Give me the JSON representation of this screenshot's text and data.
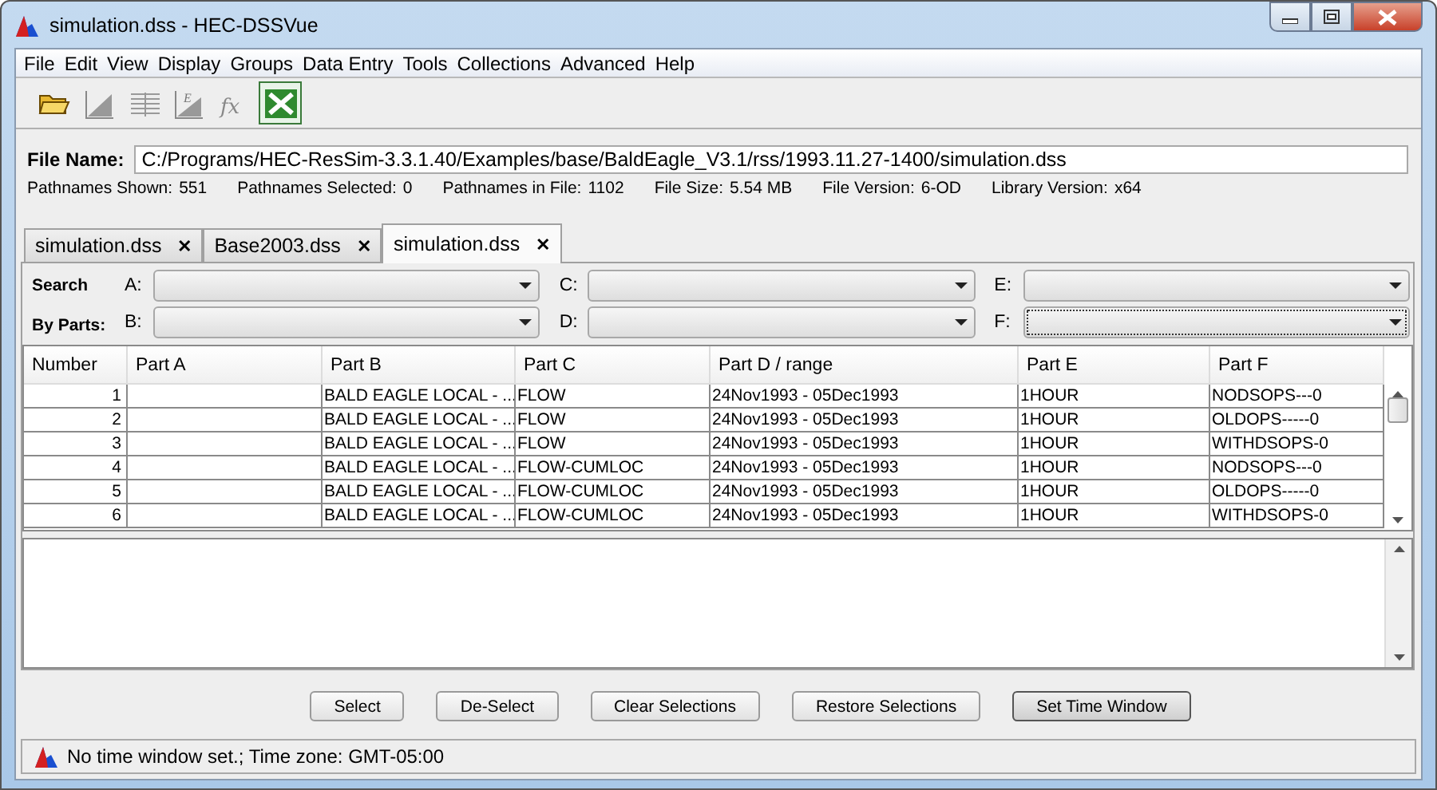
{
  "window": {
    "title": "simulation.dss - HEC-DSSVue"
  },
  "menu": [
    "File",
    "Edit",
    "View",
    "Display",
    "Groups",
    "Data Entry",
    "Tools",
    "Collections",
    "Advanced",
    "Help"
  ],
  "toolbar": [
    {
      "kind": "open"
    },
    {
      "kind": "plot"
    },
    {
      "kind": "table"
    },
    {
      "kind": "edit",
      "glyph": "E"
    },
    {
      "kind": "math",
      "glyph": "fx"
    },
    {
      "kind": "excel"
    }
  ],
  "file_name": {
    "label": "File Name:",
    "value": "C:/Programs/HEC-ResSim-3.3.1.40/Examples/base/BaldEagle_V3.1/rss/1993.11.27-1400/simulation.dss"
  },
  "info": [
    {
      "label": "Pathnames Shown:",
      "value": "551"
    },
    {
      "label": "Pathnames Selected:",
      "value": "0"
    },
    {
      "label": "Pathnames in File:",
      "value": "1102"
    },
    {
      "label": "File Size:",
      "value": "5.54  MB"
    },
    {
      "label": "File Version:",
      "value": "6-OD"
    },
    {
      "label": "Library Version:",
      "value": "x64"
    }
  ],
  "tabs": [
    {
      "label": "simulation.dss",
      "close": "✕",
      "selected": false
    },
    {
      "label": "Base2003.dss",
      "close": "✕",
      "selected": false
    },
    {
      "label": "simulation.dss",
      "close": "✕",
      "selected": true
    }
  ],
  "search": {
    "title_1": "Search",
    "title_2": "By Parts:",
    "fields": [
      {
        "label": "A:",
        "focused": false
      },
      {
        "label": "C:",
        "focused": false
      },
      {
        "label": "E:",
        "focused": false
      },
      {
        "label": "B:",
        "focused": false
      },
      {
        "label": "D:",
        "focused": false
      },
      {
        "label": "F:",
        "focused": true
      }
    ]
  },
  "table": {
    "columns": [
      "Number",
      "Part A",
      "Part B",
      "Part C",
      "Part D / range",
      "Part E",
      "Part F"
    ],
    "rows": [
      [
        "1",
        "",
        "BALD EAGLE LOCAL - ...",
        "FLOW",
        "24Nov1993 - 05Dec1993",
        "1HOUR",
        "NODSOPS---0"
      ],
      [
        "2",
        "",
        "BALD EAGLE LOCAL - ...",
        "FLOW",
        "24Nov1993 - 05Dec1993",
        "1HOUR",
        "OLDOPS-----0"
      ],
      [
        "3",
        "",
        "BALD EAGLE LOCAL - ...",
        "FLOW",
        "24Nov1993 - 05Dec1993",
        "1HOUR",
        "WITHDSOPS-0"
      ],
      [
        "4",
        "",
        "BALD EAGLE LOCAL - ...",
        "FLOW-CUMLOC",
        "24Nov1993 - 05Dec1993",
        "1HOUR",
        "NODSOPS---0"
      ],
      [
        "5",
        "",
        "BALD EAGLE LOCAL - ...",
        "FLOW-CUMLOC",
        "24Nov1993 - 05Dec1993",
        "1HOUR",
        "OLDOPS-----0"
      ],
      [
        "6",
        "",
        "BALD EAGLE LOCAL - ...",
        "FLOW-CUMLOC",
        "24Nov1993 - 05Dec1993",
        "1HOUR",
        "WITHDSOPS-0"
      ]
    ]
  },
  "buttons": [
    {
      "label": "Select",
      "default": false
    },
    {
      "label": "De-Select",
      "default": false
    },
    {
      "label": "Clear Selections",
      "default": false
    },
    {
      "label": "Restore Selections",
      "default": false
    },
    {
      "label": "Set Time Window",
      "default": true
    }
  ],
  "status_bar": {
    "text": "No time window set.;  Time zone: GMT-05:00"
  }
}
